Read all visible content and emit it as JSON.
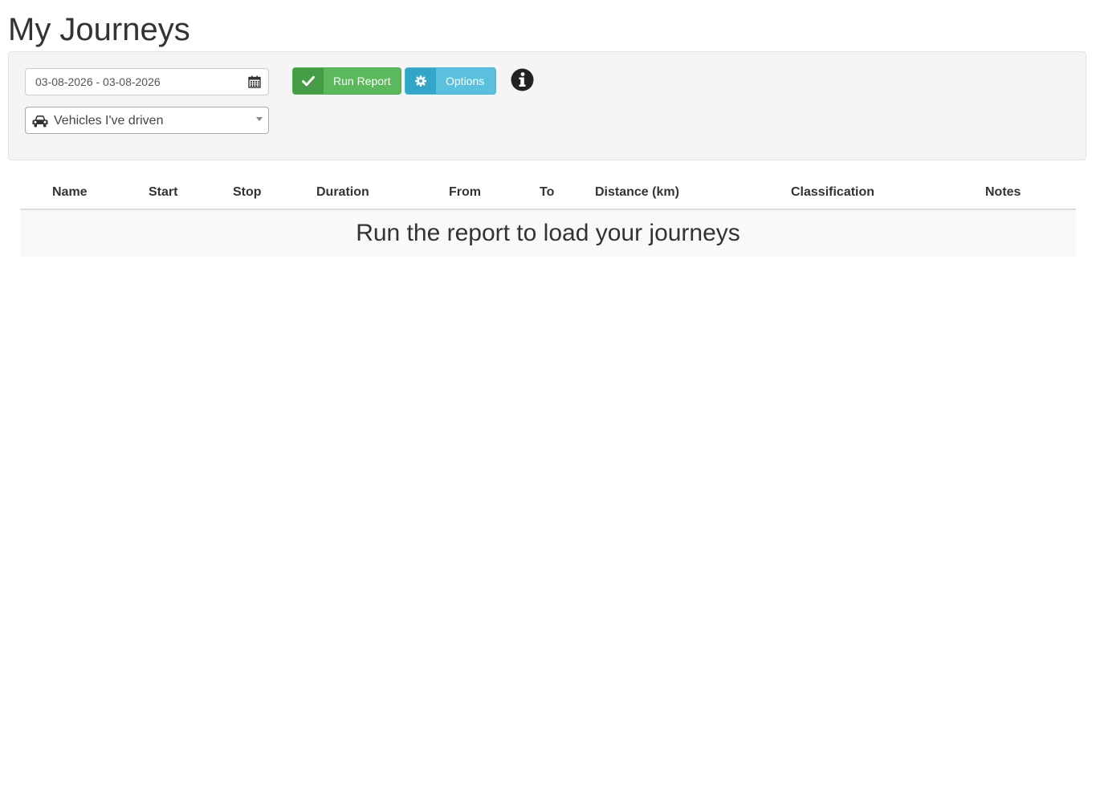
{
  "page": {
    "title": "My Journeys"
  },
  "filters": {
    "date_range_value": "03-08-2026 - 03-08-2026",
    "vehicle_select_value": "Vehicles I've driven",
    "run_report_label": "Run Report",
    "options_label": "Options",
    "icons": {
      "date": "calendar-icon",
      "vehicle": "car-icon",
      "run_report": "check-icon",
      "options": "gear-icon",
      "info": "info-icon"
    }
  },
  "table": {
    "columns": [
      "Name",
      "Start",
      "Stop",
      "Duration",
      "From",
      "To",
      "Distance (km)",
      "Classification",
      "Notes"
    ],
    "empty_message": "Run the report to load your journeys"
  },
  "colors": {
    "run_report": "#5cb85c",
    "options": "#5bc0de",
    "panel_bg": "#f5f5f5"
  }
}
